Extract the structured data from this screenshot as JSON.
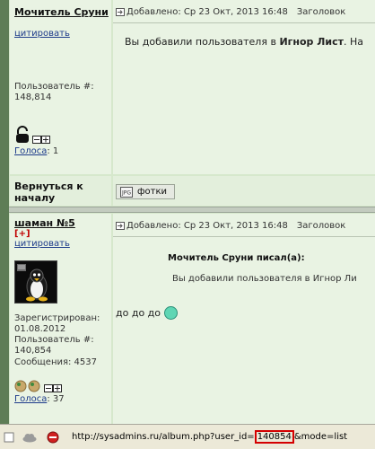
{
  "post1": {
    "author": "Мочитель Сруни",
    "header_prefix": "Добавлено: Ср 23 Окт, 2013 16:48",
    "header_subject": "Заголовок",
    "quote_link": "цитировать",
    "user_number_label": "Пользователь #:",
    "user_number": "148,814",
    "votes_label": "Голоса",
    "votes_value": ": 1",
    "body_text_before": "Вы добавили пользователя в ",
    "body_text_bold": "Игнор Лист",
    "body_text_after": ". На"
  },
  "footer_row": {
    "back_to_top": "Вернуться к началу",
    "photos_button": "фотки"
  },
  "post2": {
    "author": "шаман №5",
    "plus_badge": "[+]",
    "quote_link": "цитировать",
    "header_prefix": "Добавлено: Ср 23 Окт, 2013 16:48",
    "header_subject": "Заголовок",
    "quote_author": "Мочитель Сруни писал(а):",
    "quote_text": "Вы добавили пользователя в Игнор Ли",
    "body_text": "до до до",
    "registered_label": "Зарегистрирован:",
    "registered_date": "01.08.2012",
    "user_number_label": "Пользователь #:",
    "user_number": "140,854",
    "messages_label": "Сообщения: 4537",
    "votes_label": "Голоса",
    "votes_value": ": 37"
  },
  "statusbar": {
    "url_prefix": "http://sysadmins.ru/album.php?user_id=",
    "url_highlight": "140854",
    "url_suffix": "&mode=list"
  },
  "colors": {
    "highlight_border": "#d40000",
    "status_dot": "#5fd6b4"
  },
  "icons": [
    "lock-icon",
    "minus-plus-icon",
    "post-icon",
    "linux-penguin-avatar",
    "photo-tag-icon",
    "reputation-orb-icon",
    "cloud-icon",
    "no-entry-icon",
    "page-icon"
  ]
}
